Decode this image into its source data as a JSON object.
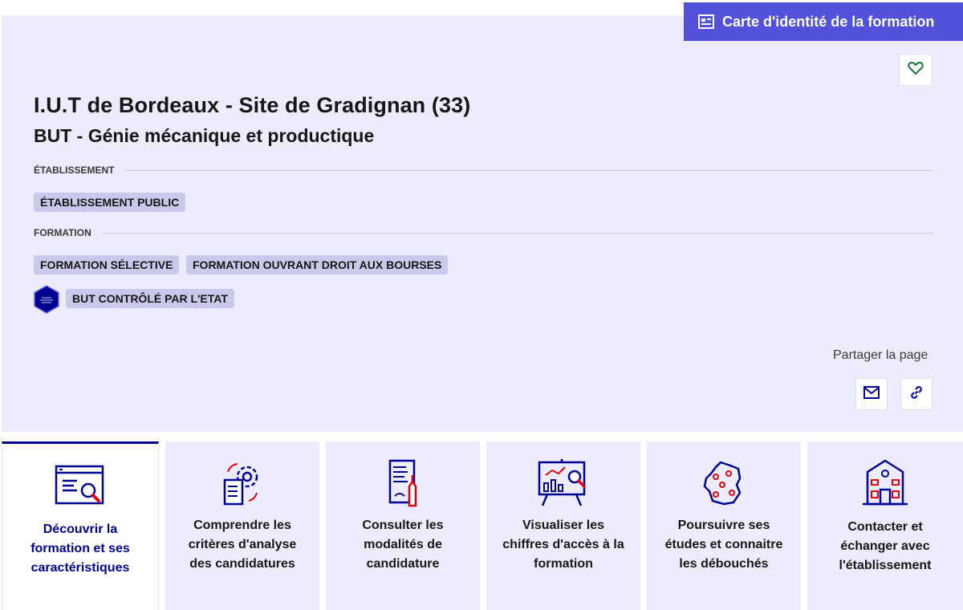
{
  "header": {
    "id_card_button": "Carte d'identité de la formation",
    "favorite_icon": "heart-outline-icon"
  },
  "school": {
    "name": "I.U.T de Bordeaux - Site de Gradignan (33)",
    "program": "BUT - Génie mécanique et productique"
  },
  "etablissement": {
    "label": "ÉTABLISSEMENT",
    "tags": [
      "ÉTABLISSEMENT PUBLIC"
    ]
  },
  "formation": {
    "label": "FORMATION",
    "tags": [
      "FORMATION SÉLECTIVE",
      "FORMATION OUVRANT DROIT AUX BOURSES"
    ],
    "label_badge": "BUT CONTRÔLÉ PAR L'ETAT"
  },
  "share": {
    "label": "Partager la page",
    "mail_icon": "mail-icon",
    "link_icon": "link-icon"
  },
  "tabs": [
    {
      "lines": [
        "Découvrir la",
        "formation et ses",
        "caractéristiques"
      ],
      "icon": "search-document-icon",
      "active": true
    },
    {
      "lines": [
        "Comprendre les",
        "critères d'analyse",
        "des candidatures"
      ],
      "icon": "document-gear-icon",
      "active": false
    },
    {
      "lines": [
        "Consulter les",
        "modalités de",
        "candidature"
      ],
      "icon": "document-pen-icon",
      "active": false
    },
    {
      "lines": [
        "Visualiser les",
        "chiffres d'accès à la",
        "formation"
      ],
      "icon": "chart-board-icon",
      "active": false
    },
    {
      "lines": [
        "Poursuivre ses",
        "études et connaitre",
        "les débouchés"
      ],
      "icon": "france-map-icon",
      "active": false
    },
    {
      "lines": [
        "Contacter et",
        "échanger avec",
        "l'établissement"
      ],
      "icon": "school-building-icon",
      "active": false
    }
  ],
  "colors": {
    "primary_blue": "#000091",
    "button_blue": "#5151d9",
    "hero_background": "#ececfe",
    "tag_background": "#c9c9eb",
    "accent_red": "#e1000f"
  }
}
